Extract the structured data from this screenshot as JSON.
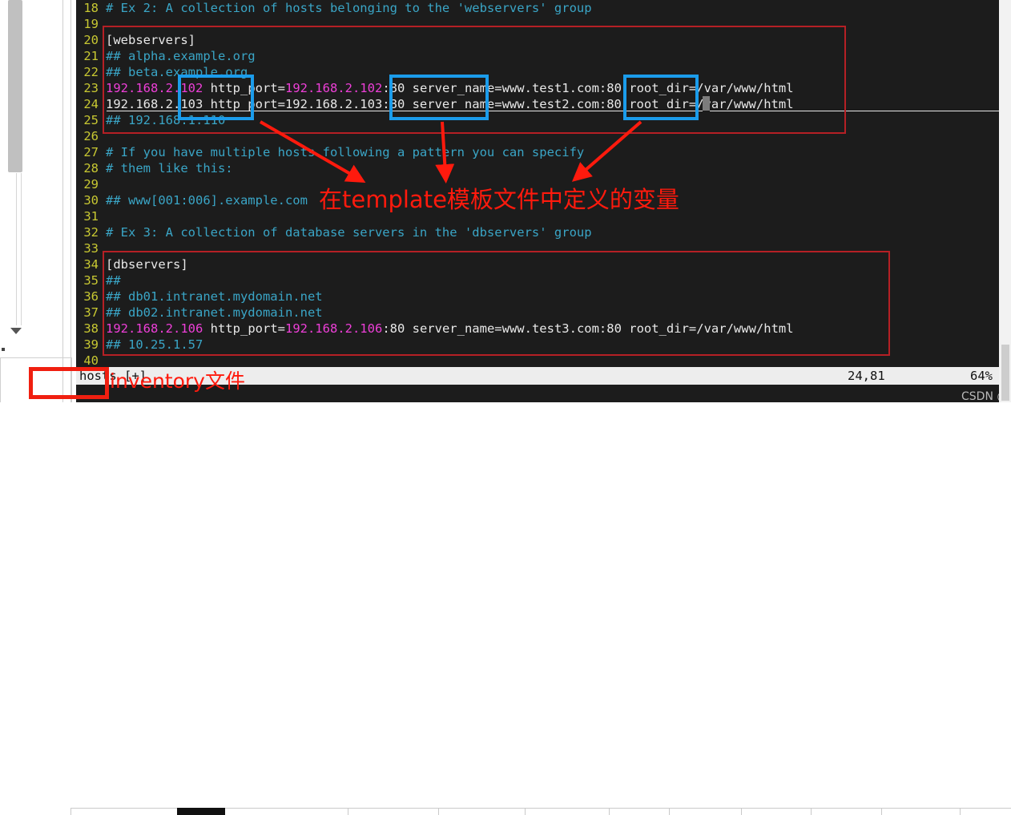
{
  "editor": {
    "name": "vim",
    "filename": "hosts [+]",
    "cursor_position": "24,81",
    "scroll_percent": "64%",
    "first_line_number": 18,
    "lines": [
      {
        "num": "18",
        "segments": [
          {
            "text": "# Ex 2: A collection of hosts belonging to the 'webservers' group",
            "cls": "c-comment"
          }
        ]
      },
      {
        "num": "19",
        "segments": [
          {
            "text": "",
            "cls": "c-white"
          }
        ]
      },
      {
        "num": "20",
        "segments": [
          {
            "text": "[webservers]",
            "cls": "c-white"
          }
        ]
      },
      {
        "num": "21",
        "segments": [
          {
            "text": "## alpha.example.org",
            "cls": "c-comment"
          }
        ]
      },
      {
        "num": "22",
        "segments": [
          {
            "text": "## beta.example.org",
            "cls": "c-comment"
          }
        ]
      },
      {
        "num": "23",
        "segments": [
          {
            "text": "192.168.2.102",
            "cls": "c-ip"
          },
          {
            "text": " http_port=",
            "cls": "c-white"
          },
          {
            "text": "192.168.2.102",
            "cls": "c-ip"
          },
          {
            "text": ":80 server_name=www.test1.com:80 root_dir=/var/www/html",
            "cls": "c-white"
          }
        ]
      },
      {
        "num": "24",
        "segments": [
          {
            "text": "192.168.2.103 http_port=192.168.2.103:80 server_name=www.test2.com:80 root_dir=/var/www/html",
            "cls": "c-white"
          }
        ]
      },
      {
        "num": "25",
        "segments": [
          {
            "text": "## 192.168.1.110",
            "cls": "c-comment"
          }
        ]
      },
      {
        "num": "26",
        "segments": [
          {
            "text": "",
            "cls": "c-white"
          }
        ]
      },
      {
        "num": "27",
        "segments": [
          {
            "text": "# If you have multiple hosts following a pattern you can specify",
            "cls": "c-comment"
          }
        ]
      },
      {
        "num": "28",
        "segments": [
          {
            "text": "# them like this:",
            "cls": "c-comment"
          }
        ]
      },
      {
        "num": "29",
        "segments": [
          {
            "text": "",
            "cls": "c-white"
          }
        ]
      },
      {
        "num": "30",
        "segments": [
          {
            "text": "## www[001:006].example.com",
            "cls": "c-comment"
          }
        ]
      },
      {
        "num": "31",
        "segments": [
          {
            "text": "",
            "cls": "c-white"
          }
        ]
      },
      {
        "num": "32",
        "segments": [
          {
            "text": "# Ex 3: A collection of database servers in the 'dbservers' group",
            "cls": "c-comment"
          }
        ]
      },
      {
        "num": "33",
        "segments": [
          {
            "text": "",
            "cls": "c-white"
          }
        ]
      },
      {
        "num": "34",
        "segments": [
          {
            "text": "[dbservers]",
            "cls": "c-white"
          }
        ]
      },
      {
        "num": "35",
        "segments": [
          {
            "text": "##",
            "cls": "c-comment"
          }
        ]
      },
      {
        "num": "36",
        "segments": [
          {
            "text": "## db01.intranet.mydomain.net",
            "cls": "c-comment"
          }
        ]
      },
      {
        "num": "37",
        "segments": [
          {
            "text": "## db02.intranet.mydomain.net",
            "cls": "c-comment"
          }
        ]
      },
      {
        "num": "38",
        "segments": [
          {
            "text": "192.168.2.106",
            "cls": "c-ip"
          },
          {
            "text": " http_port=",
            "cls": "c-white"
          },
          {
            "text": "192.168.2.106",
            "cls": "c-ip"
          },
          {
            "text": ":80 server_name=www.test3.com:80 root_dir=/var/www/html",
            "cls": "c-white"
          }
        ]
      },
      {
        "num": "39",
        "segments": [
          {
            "text": "## 10.25.1.57",
            "cls": "c-comment"
          }
        ]
      },
      {
        "num": "40",
        "segments": [
          {
            "text": "",
            "cls": "c-white"
          }
        ]
      }
    ]
  },
  "annotations": {
    "variables_label": "在template模板文件中定义的变量",
    "inventory_label": "inventory文件",
    "colors": {
      "red": "#ff1a0d",
      "dark_red": "#b52025",
      "blue": "#1b9ceb",
      "bright_red": "#f01f10"
    },
    "blue_boxes": [
      {
        "name": "http_port-variable-box"
      },
      {
        "name": "server_name-variable-box"
      },
      {
        "name": "root_dir-variable-box"
      }
    ],
    "red_boxes": [
      {
        "name": "webservers-group-box"
      },
      {
        "name": "dbservers-group-box"
      },
      {
        "name": "filename-box"
      }
    ]
  },
  "watermark": {
    "text": "CSDN @白幽幽白"
  }
}
